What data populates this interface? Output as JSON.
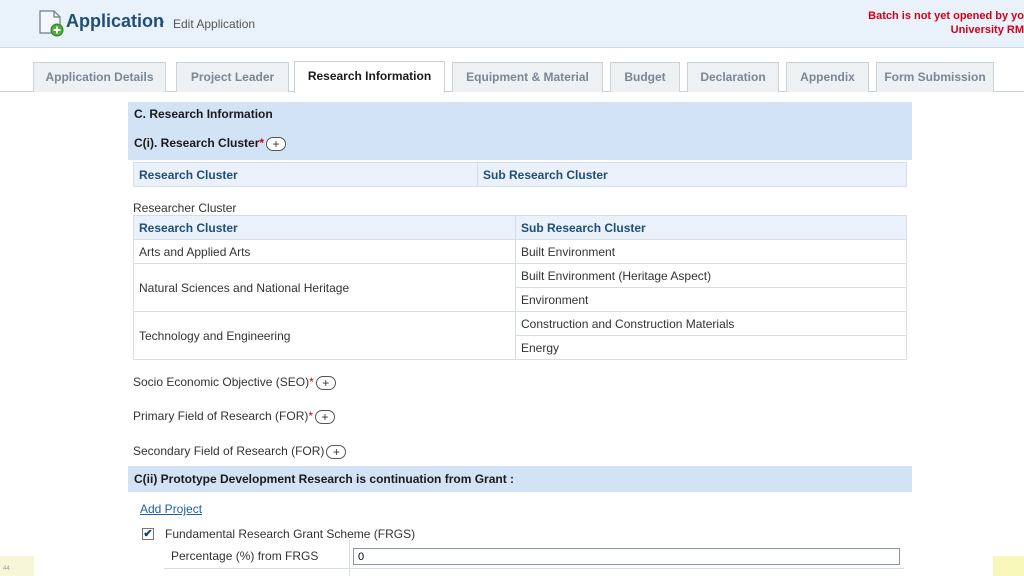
{
  "header": {
    "title": "Application",
    "separator": "›",
    "subtitle": "Edit Application",
    "batch_line1": "Batch is not yet opened by yo",
    "batch_line2": "University RM"
  },
  "tabs": [
    {
      "label": "Application Details",
      "active": false
    },
    {
      "label": "Project Leader",
      "active": false
    },
    {
      "label": "Research Information",
      "active": true
    },
    {
      "label": "Equipment & Material",
      "active": false
    },
    {
      "label": "Budget",
      "active": false
    },
    {
      "label": "Declaration",
      "active": false
    },
    {
      "label": "Appendix",
      "active": false
    },
    {
      "label": "Form Submission",
      "active": false
    }
  ],
  "section_c": {
    "title": "C. Research Information",
    "cluster_heading": "C(i). Research Cluster",
    "required_mark": "*",
    "plus": "+",
    "table_headers": [
      "Research Cluster",
      "Sub Research Cluster"
    ]
  },
  "researcher_cluster": {
    "label": "Researcher Cluster",
    "headers": [
      "Research Cluster",
      "Sub Research Cluster"
    ],
    "rows": [
      {
        "cluster": "Arts and Applied Arts",
        "subs": [
          "Built Environment"
        ]
      },
      {
        "cluster": "Natural Sciences and National Heritage",
        "subs": [
          "Built Environment (Heritage Aspect)",
          "Environment"
        ]
      },
      {
        "cluster": "Technology and Engineering",
        "subs": [
          "Construction and Construction Materials",
          "Energy"
        ]
      }
    ]
  },
  "fields": {
    "seo": "Socio Economic Objective (SEO)",
    "primary_for": "Primary Field of Research (FOR)",
    "secondary_for": "Secondary Field of Research (FOR)"
  },
  "section_cii": {
    "title": "C(ii) Prototype Development Research is continuation from Grant :",
    "add_project": "Add Project",
    "grant_checkbox_label": "Fundamental Research Grant Scheme (FRGS)",
    "grant_checked": true,
    "check_mark": "✔",
    "percentage_label": "Percentage (%) from FRGS",
    "percentage_value": "0"
  },
  "footer": {
    "page_number": "44"
  }
}
